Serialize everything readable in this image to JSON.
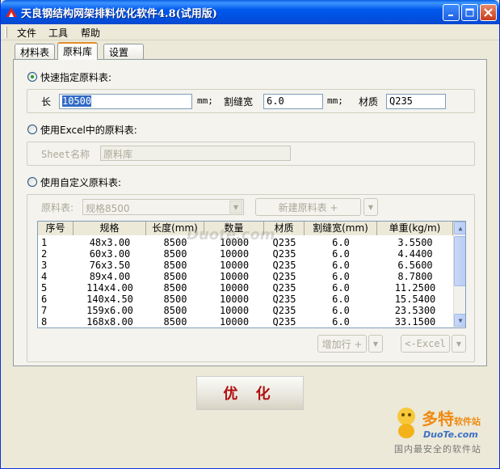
{
  "window": {
    "title": "天良钢结构网架排料优化软件4.8(试用版)"
  },
  "menu": [
    "文件",
    "工具",
    "帮助"
  ],
  "tabs": [
    "材料表",
    "原料库",
    "设置"
  ],
  "quick": {
    "label": "快速指定原料表:",
    "length_label": "长",
    "length_value": "10500",
    "unit1": "mm;",
    "kerf_label": "割缝宽",
    "kerf_value": "6.0",
    "unit2": "mm;",
    "material_label": "材质",
    "material_value": "Q235"
  },
  "excel": {
    "label": "使用Excel中的原料表:",
    "sheet_label": "Sheet名称",
    "sheet_value": "原料库"
  },
  "custom": {
    "label": "使用自定义原料表:",
    "table_label": "原料表:",
    "table_value": "规格8500",
    "new_button": "新建原料表 +",
    "add_row_button": "增加行 +",
    "excel_button": "<-Excel"
  },
  "grid": {
    "columns": [
      "序号",
      "规格",
      "长度(mm)",
      "数量",
      "材质",
      "割缝宽(mm)",
      "单重(kg/m)"
    ],
    "rows": [
      [
        "1",
        "48x3.00",
        "8500",
        "10000",
        "Q235",
        "6.0",
        "3.5500"
      ],
      [
        "2",
        "60x3.00",
        "8500",
        "10000",
        "Q235",
        "6.0",
        "4.4400"
      ],
      [
        "3",
        "76x3.50",
        "8500",
        "10000",
        "Q235",
        "6.0",
        "6.5600"
      ],
      [
        "4",
        "89x4.00",
        "8500",
        "10000",
        "Q235",
        "6.0",
        "8.7800"
      ],
      [
        "5",
        "114x4.00",
        "8500",
        "10000",
        "Q235",
        "6.0",
        "11.2500"
      ],
      [
        "6",
        "140x4.50",
        "8500",
        "10000",
        "Q235",
        "6.0",
        "15.5400"
      ],
      [
        "7",
        "159x6.00",
        "8500",
        "10000",
        "Q235",
        "6.0",
        "23.5300"
      ],
      [
        "8",
        "168x8.00",
        "8500",
        "10000",
        "Q235",
        "6.0",
        "33.1500"
      ]
    ]
  },
  "optimize_button": "优 化",
  "watermark": {
    "brand": "多特",
    "brand_sub": "软件站",
    "domain": "DuoTe.com",
    "slogan": "国内最安全的软件站",
    "grid_overlay": "Duote.com"
  }
}
